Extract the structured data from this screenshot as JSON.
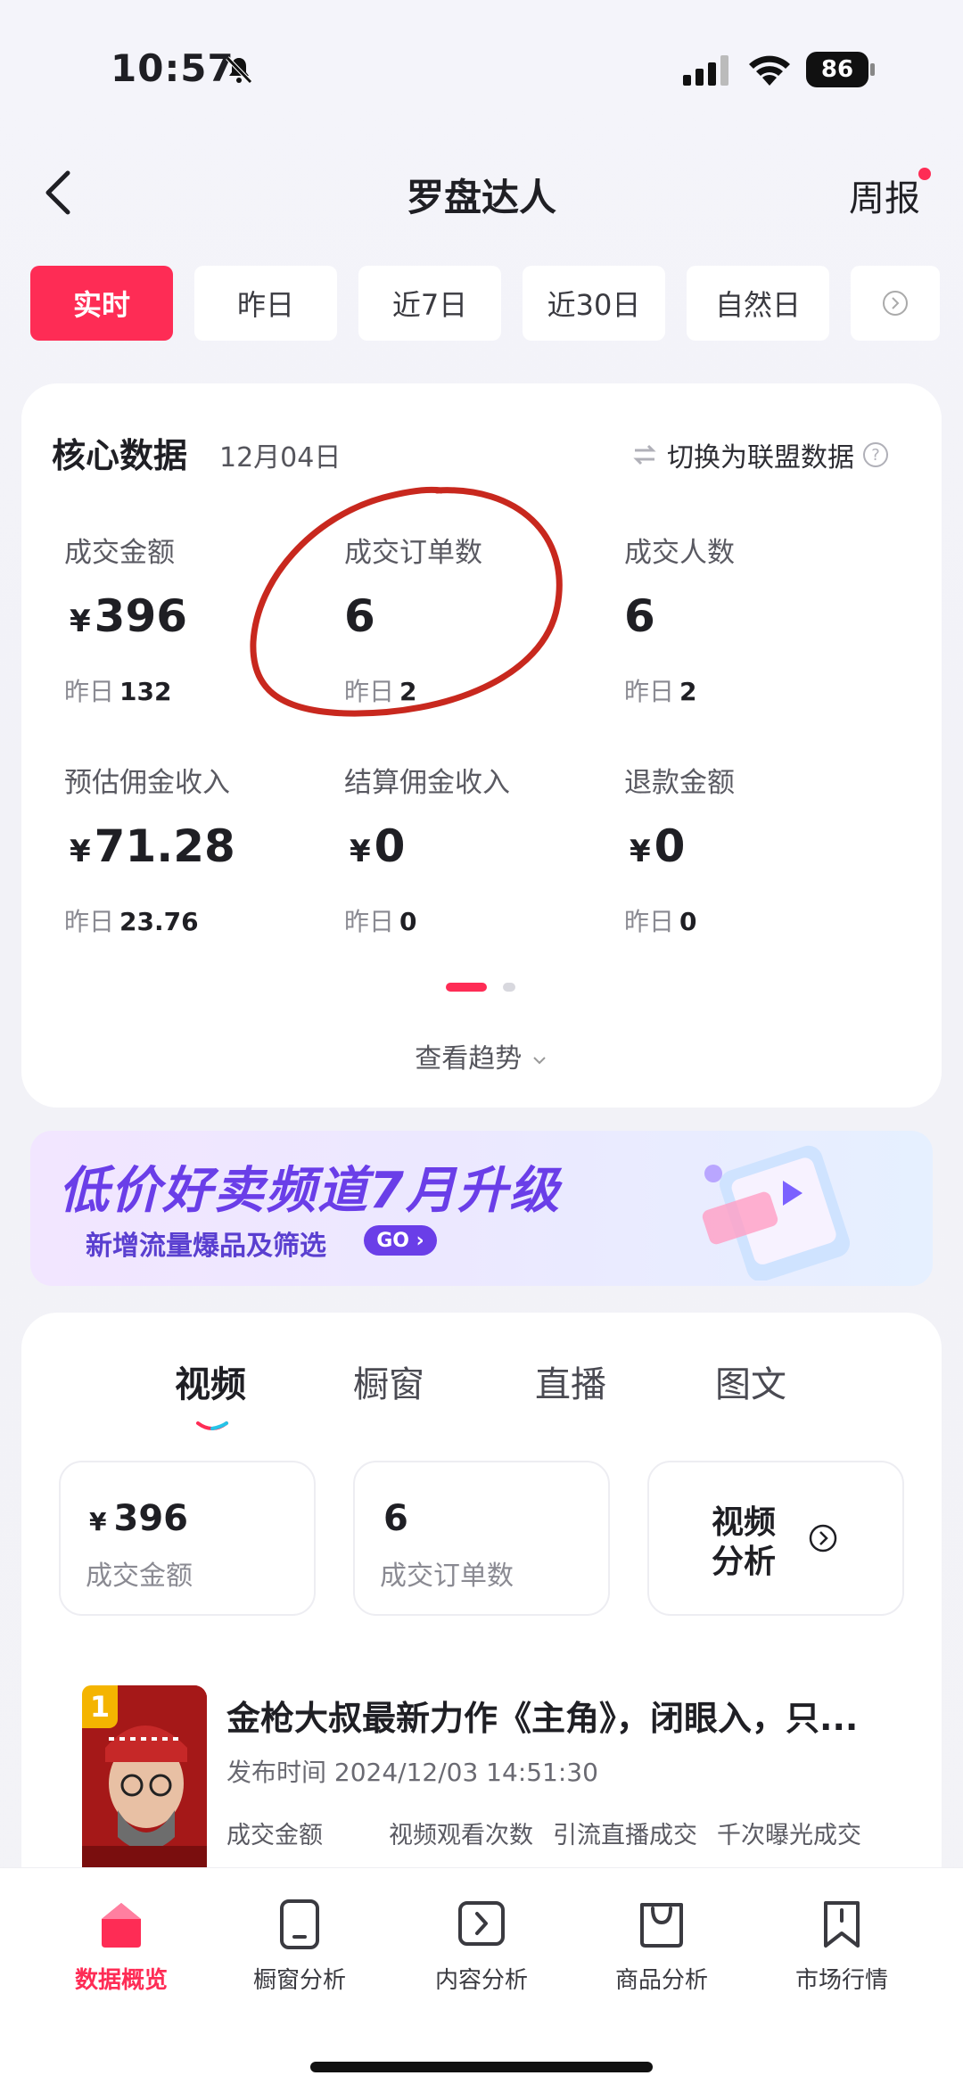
{
  "status_bar": {
    "time": "10:57",
    "battery": "86"
  },
  "header": {
    "title": "罗盘达人",
    "weekly_label": "周报"
  },
  "date_tabs": [
    "实时",
    "昨日",
    "近7日",
    "近30日",
    "自然日"
  ],
  "core": {
    "title": "核心数据",
    "date": "12月04日",
    "switch_label": "切换为联盟数据",
    "yesterday_prefix": "昨日",
    "currency": "¥",
    "metrics": [
      {
        "label": "成交金额",
        "value": "396",
        "yesterday": "132"
      },
      {
        "label": "成交订单数",
        "value": "6",
        "yesterday": "2"
      },
      {
        "label": "成交人数",
        "value": "6",
        "yesterday": "2"
      },
      {
        "label": "预估佣金收入",
        "value": "71.28",
        "yesterday": "23.76"
      },
      {
        "label": "结算佣金收入",
        "value": "0",
        "yesterday": "0"
      },
      {
        "label": "退款金额",
        "value": "0",
        "yesterday": "0"
      }
    ],
    "trend_link": "查看趋势"
  },
  "banner": {
    "title": "低价好卖频道7月升级",
    "subtitle": "新增流量爆品及筛选",
    "go": "GO"
  },
  "content": {
    "tabs": [
      "视频",
      "橱窗",
      "直播",
      "图文"
    ],
    "summary": [
      {
        "value": "396",
        "label": "成交金额"
      },
      {
        "value": "6",
        "label": "成交订单数"
      }
    ],
    "analysis_label": "视频分析",
    "video": {
      "rank": "1",
      "title": "金枪大叔最新力作《主角》，闭眼入，只...",
      "publish_time": "发布时间 2024/12/03 14:51:30",
      "metric_labels": [
        "成交金额",
        "视频观看次数",
        "引流直播成交",
        "千次曝光成交"
      ]
    }
  },
  "bottom_nav": [
    "数据概览",
    "橱窗分析",
    "内容分析",
    "商品分析",
    "市场行情"
  ],
  "colors": {
    "accent": "#fe2c55",
    "banner_purple": "#6a3ee8"
  }
}
